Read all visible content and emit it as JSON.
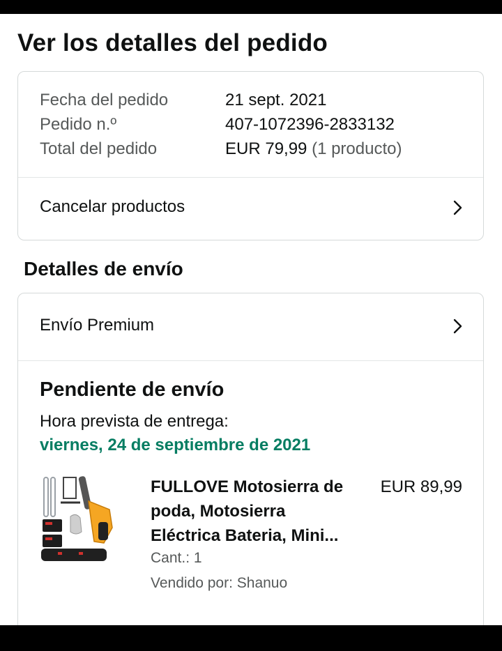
{
  "page": {
    "title": "Ver los detalles del pedido"
  },
  "order": {
    "date_label": "Fecha del pedido",
    "date_value": "21 sept. 2021",
    "number_label": "Pedido n.º",
    "number_value": "407-1072396-2833132",
    "total_label": "Total del pedido",
    "total_value": "EUR 79,99",
    "total_items": "(1 producto)",
    "cancel_label": "Cancelar productos"
  },
  "shipping": {
    "section_title": "Detalles de envío",
    "method_label": "Envío Premium",
    "status_title": "Pendiente de envío",
    "delivery_label": "Hora prevista de entrega:",
    "delivery_date": "viernes, 24 de septiembre de 2021"
  },
  "product": {
    "title": "FULLOVE Motosierra de poda, Motosierra Eléctrica Bateria, Mini...",
    "price": "EUR 89,99",
    "quantity": "Cant.: 1",
    "seller": "Vendido por: Shanuo",
    "image_icon": "chainsaw-kit-image"
  },
  "colors": {
    "delivery_green": "#067d62",
    "border": "#d5d9d9",
    "muted_text": "#565959",
    "product_orange": "#f5a623"
  }
}
